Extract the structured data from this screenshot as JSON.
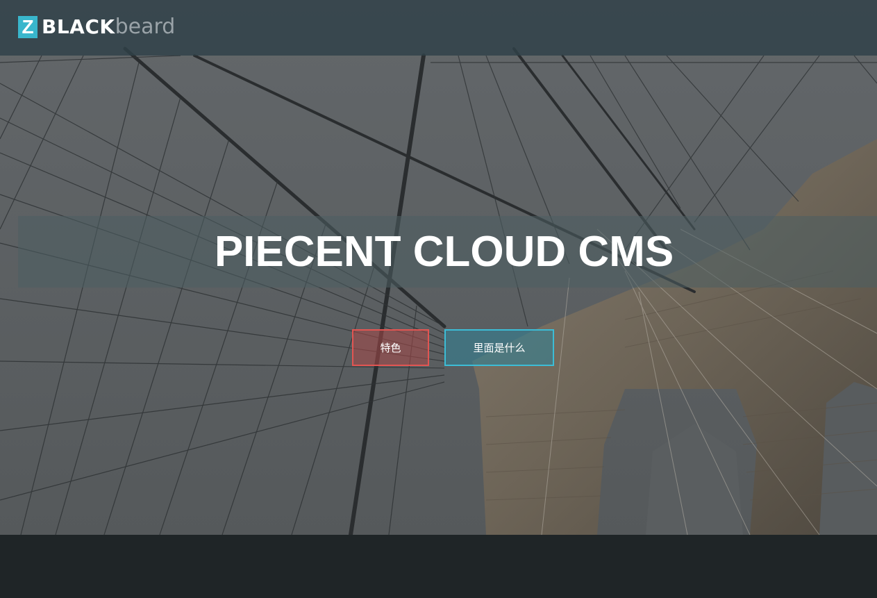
{
  "header": {
    "logo": {
      "mark": "Z",
      "strong": "BLACK",
      "light": "beard"
    }
  },
  "hero": {
    "title": "PIECENT CLOUD CMS",
    "buttons": {
      "features_label": "特色",
      "inside_label": "里面是什么"
    }
  },
  "colors": {
    "accent_cyan": "#39b6cc",
    "button_red_border": "#e25552",
    "button_cyan_border": "#3cbdd6",
    "header_bg": "#2f4148",
    "footer_bg": "#1f2527"
  },
  "icons": {
    "background": "bridge-cables-photo"
  }
}
